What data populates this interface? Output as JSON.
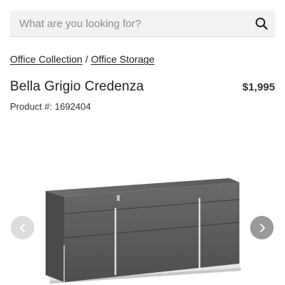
{
  "search": {
    "placeholder": "What are you looking for?",
    "value": ""
  },
  "breadcrumb": {
    "items": [
      {
        "label": "Office Collection"
      },
      {
        "label": "Office Storage"
      }
    ],
    "separator": "/"
  },
  "product": {
    "title": "Bella Grigio Credenza",
    "price": "$1,995",
    "number_label": "Product #: 1692404"
  },
  "gallery": {
    "prev_icon": "chevron-left-icon",
    "next_icon": "chevron-right-icon",
    "image_subject": "grey credenza with drawers"
  },
  "colors": {
    "search_bg": "#f2f2f2",
    "text": "#222222",
    "nav_prev_bg": "#dcdcdc",
    "nav_next_bg": "#9a9a9a",
    "credenza_grey": "#5f5f5f"
  }
}
